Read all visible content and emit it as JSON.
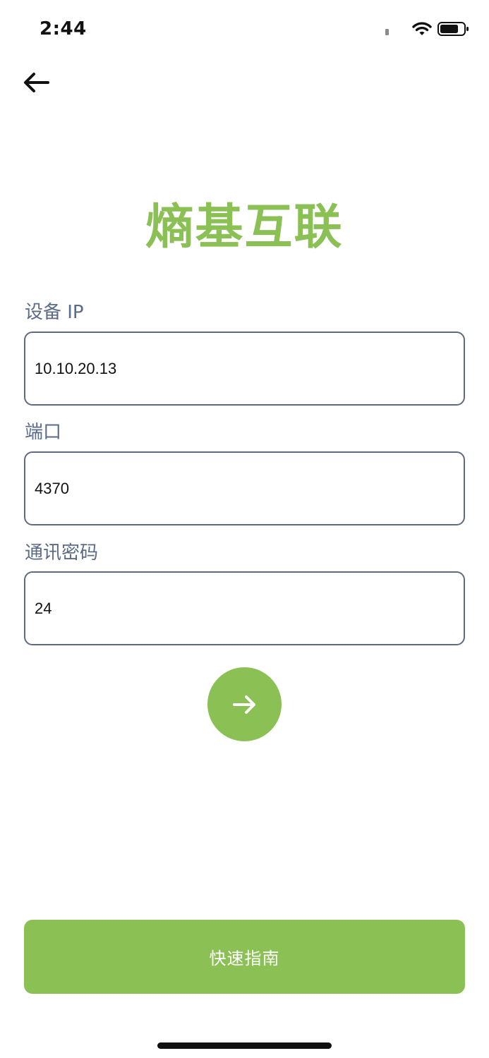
{
  "status_bar": {
    "time": "2:44",
    "icons": [
      "signal-icon",
      "wifi-icon",
      "battery-icon"
    ]
  },
  "header": {
    "back_icon": "arrow-left-icon"
  },
  "title": "熵基互联",
  "form": {
    "ip": {
      "label": "设备 IP",
      "value": "10.10.20.13"
    },
    "port": {
      "label": "端口",
      "value": "4370"
    },
    "password": {
      "label": "通讯密码",
      "value": "24"
    },
    "submit_icon": "arrow-right-icon"
  },
  "guide_button": {
    "label": "快速指南"
  },
  "colors": {
    "accent": "#8bc055",
    "label": "#5c6b86",
    "border": "#5f6a80"
  }
}
